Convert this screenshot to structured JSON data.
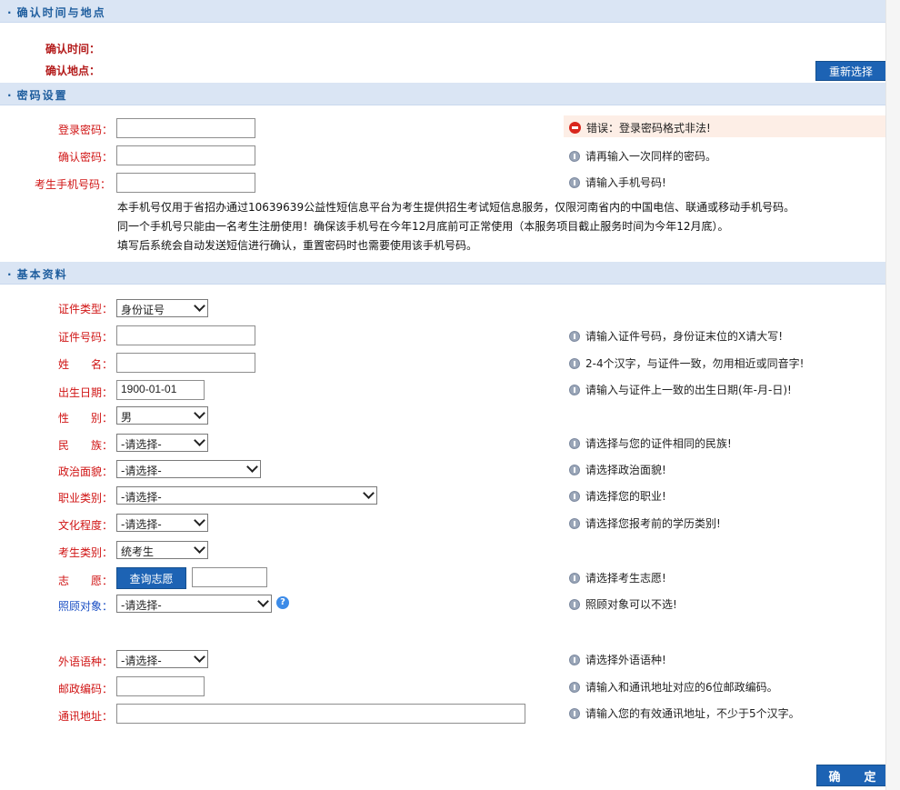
{
  "sections": {
    "confirm": "确认时间与地点",
    "password": "密码设置",
    "basic": "基本资料"
  },
  "confirm": {
    "time_label": "确认时间：",
    "place_label": "确认地点：",
    "reselect_button": "重新选择"
  },
  "password": {
    "login_pw_label": "登录密码：",
    "confirm_pw_label": "确认密码：",
    "phone_label": "考生手机号码：",
    "login_pw_error": "错误：登录密码格式非法!",
    "confirm_pw_hint": "请再输入一次同样的密码。",
    "phone_hint": "请输入手机号码!",
    "notes": [
      "本手机号仅用于省招办通过10639639公益性短信息平台为考生提供招生考试短信息服务，仅限河南省内的中国电信、联通或移动手机号码。",
      "同一个手机号只能由一名考生注册使用！确保该手机号在今年12月底前可正常使用（本服务项目截止服务时间为今年12月底）。",
      "填写后系统会自动发送短信进行确认，重置密码时也需要使用该手机号码。"
    ]
  },
  "basic": {
    "id_type_label": "证件类型：",
    "id_type_value": "身份证号",
    "id_no_label": "证件号码：",
    "id_no_hint": "请输入证件号码，身份证末位的X请大写!",
    "name_label": "姓　　名：",
    "name_hint": "2-4个汉字，与证件一致，勿用相近或同音字!",
    "dob_label": "出生日期：",
    "dob_value": "1900-01-01",
    "dob_hint": "请输入与证件上一致的出生日期(年-月-日)!",
    "gender_label": "性　　别：",
    "gender_value": "男",
    "ethnic_label": "民　　族：",
    "ethnic_value": "-请选择-",
    "ethnic_hint": "请选择与您的证件相同的民族!",
    "political_label": "政治面貌：",
    "political_value": "-请选择-",
    "political_hint": "请选择政治面貌!",
    "job_label": "职业类别：",
    "job_value": "-请选择-",
    "job_hint": "请选择您的职业!",
    "edu_label": "文化程度：",
    "edu_value": "-请选择-",
    "edu_hint": "请选择您报考前的学历类别!",
    "category_label": "考生类别：",
    "category_value": "统考生",
    "wish_label": "志　　愿：",
    "wish_button": "查询志愿",
    "wish_hint": "请选择考生志愿!",
    "care_label": "照顾对象：",
    "care_value": "-请选择-",
    "care_help": "?",
    "care_hint": "照顾对象可以不选!",
    "lang_label": "外语语种：",
    "lang_value": "-请选择-",
    "lang_hint": "请选择外语语种!",
    "zip_label": "邮政编码：",
    "zip_hint": "请输入和通讯地址对应的6位邮政编码。",
    "addr_label": "通讯地址：",
    "addr_hint": "请输入您的有效通讯地址，不少于5个汉字。",
    "submit_button": "确　　定"
  }
}
